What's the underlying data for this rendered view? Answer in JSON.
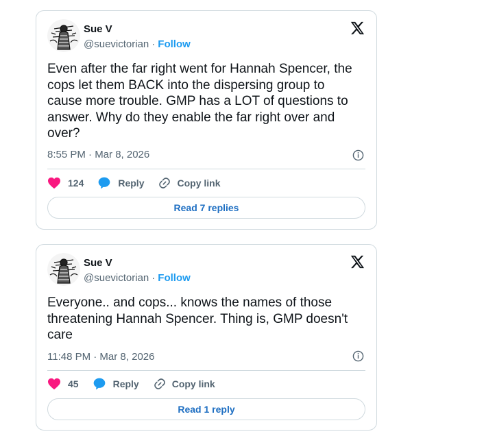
{
  "tweets": [
    {
      "author_name": "Sue V",
      "handle": "@suevictorian",
      "separator": "·",
      "follow_label": "Follow",
      "text": "Even after the far right went for Hannah Spencer, the\ncops let them BACK into the dispersing group to\ncause more trouble. GMP has a LOT of questions to\nanswer. Why do they enable the far right over and\nover?",
      "timestamp": "8:55 PM · Mar 8, 2026",
      "likes": "124",
      "reply_label": "Reply",
      "copy_label": "Copy link",
      "read_replies_label": "Read 7 replies"
    },
    {
      "author_name": "Sue V",
      "handle": "@suevictorian",
      "separator": "·",
      "follow_label": "Follow",
      "text": "Everyone.. and cops... knows the names of those\nthreatening Hannah Spencer. Thing is, GMP doesn't\ncare",
      "timestamp": "11:48 PM · Mar 8, 2026",
      "likes": "45",
      "reply_label": "Reply",
      "copy_label": "Copy link",
      "read_replies_label": "Read 1 reply"
    }
  ],
  "colors": {
    "like": "#f91880",
    "reply": "#1d9bf0",
    "follow": "#1d9bf0",
    "read_button_text": "#1d6ec2",
    "border": "#cfd9de",
    "muted": "#536471"
  },
  "icons": [
    "x-logo-icon",
    "info-icon",
    "heart-icon",
    "reply-bubble-icon",
    "link-icon",
    "avatar-illustration"
  ]
}
